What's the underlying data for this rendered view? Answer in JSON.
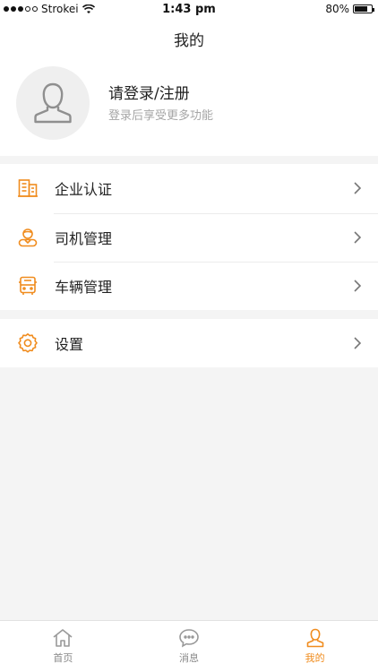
{
  "status_bar": {
    "carrier": "Strokei",
    "time": "1:43 pm",
    "battery": "80%",
    "battery_level": 0.8
  },
  "nav": {
    "title": "我的"
  },
  "profile": {
    "title": "请登录/注册",
    "subtitle": "登录后享受更多功能",
    "avatar_icon": "user-placeholder-icon"
  },
  "menu": {
    "items": [
      {
        "label": "企业认证",
        "icon": "building-icon"
      },
      {
        "label": "司机管理",
        "icon": "driver-icon"
      },
      {
        "label": "车辆管理",
        "icon": "bus-icon"
      }
    ],
    "settings": {
      "label": "设置",
      "icon": "gear-icon"
    }
  },
  "tab_bar": {
    "tabs": [
      {
        "label": "首页",
        "icon": "home-icon"
      },
      {
        "label": "消息",
        "icon": "message-icon"
      },
      {
        "label": "我的",
        "icon": "user-icon"
      }
    ],
    "active": "我的"
  },
  "colors": {
    "accent": "#f08c1e",
    "text": "#222222",
    "subtext": "#a6a6a6",
    "background": "#f4f4f4"
  }
}
